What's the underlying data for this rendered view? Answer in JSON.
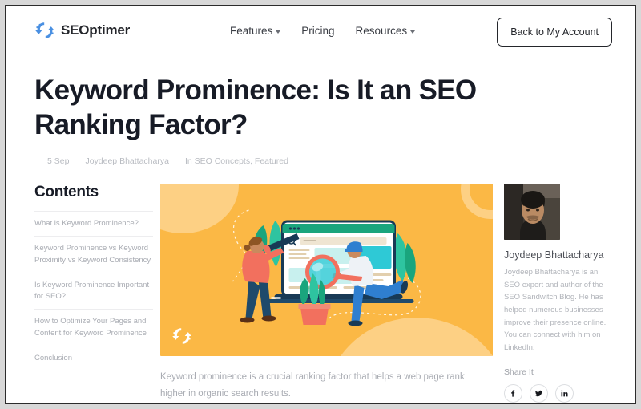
{
  "header": {
    "logo_text": "SEOptimer",
    "logo_icon": "seoptimer-gear-arrows-icon",
    "nav": [
      {
        "label": "Features",
        "has_caret": true
      },
      {
        "label": "Pricing",
        "has_caret": false
      },
      {
        "label": "Resources",
        "has_caret": true
      }
    ],
    "account_button": "Back to My Account"
  },
  "article": {
    "title": "Keyword Prominence: Is It an SEO Ranking Factor?",
    "date": "5 Sep",
    "author": "Joydeep Bhattacharya",
    "categories": "In SEO Concepts, Featured",
    "lede": "Keyword prominence is a crucial ranking factor that helps a web page rank higher in organic search results."
  },
  "contents": {
    "title": "Contents",
    "items": [
      "What is Keyword Prominence?",
      "Keyword Prominence vs Keyword Proximity vs Keyword Consistency",
      "Is Keyword Prominence Important for SEO?",
      "How to Optimize Your Pages and Content for Keyword Prominence",
      "Conclusion"
    ]
  },
  "hero": {
    "alt": "Illustration of two people inspecting a website on a laptop with a magnifying glass and telescope",
    "background_color": "#fbb845",
    "accent_color": "#fdd084",
    "watermark_icon": "seoptimer-logo-watermark-icon"
  },
  "author_card": {
    "avatar_alt": "Photo of Joydeep Bhattacharya",
    "name": "Joydeep Bhattacharya",
    "bio": "Joydeep Bhattacharya is an SEO expert and author of the SEO Sandwitch Blog. He has helped numerous businesses improve their presence online. You can connect with him on LinkedIn."
  },
  "share": {
    "label": "Share It",
    "buttons": [
      {
        "name": "facebook-icon",
        "title": "Facebook"
      },
      {
        "name": "twitter-icon",
        "title": "Twitter"
      },
      {
        "name": "linkedin-icon",
        "title": "LinkedIn"
      }
    ]
  }
}
